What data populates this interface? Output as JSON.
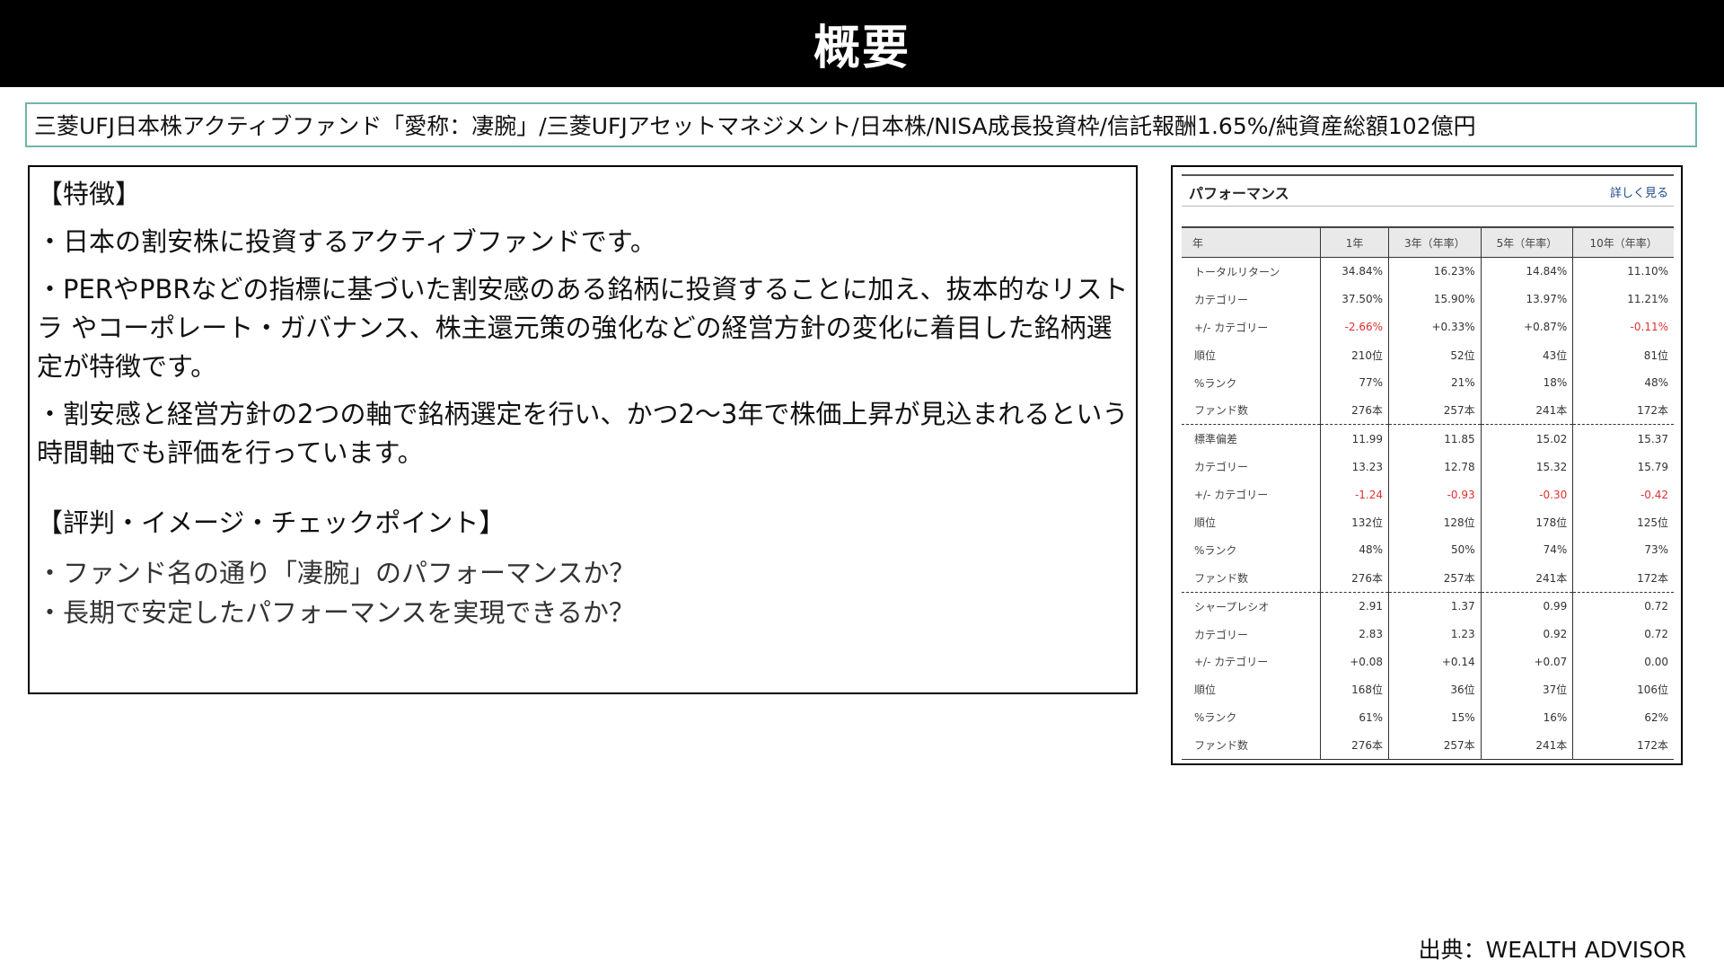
{
  "header": {
    "title": "概要"
  },
  "fund_line": "三菱UFJ日本株アクティブファンド「愛称：凄腕」/三菱UFJアセットマネジメント/日本株/NISA成長投資枠/信託報酬1.65%/純資産総額102億円",
  "features": {
    "heading": "【特徴】",
    "paragraphs": [
      "・日本の割安株に投資するアクティブファンドです。",
      "・PERやPBRなどの指標に基づいた割安感のある銘柄に投資することに加え、抜本的なリストラ やコーポレート・ガバナンス、株主還元策の強化などの経営方針の変化に着目した銘柄選定が特徴です。",
      "・割安感と経営方針の2つの軸で銘柄選定を行い、かつ2～3年で株価上昇が見込まれるという時間軸でも評価を行っています。"
    ]
  },
  "checkpoints": {
    "heading": "【評判・イメージ・チェックポイント】",
    "items": [
      "・ファンド名の通り「凄腕」のパフォーマンスか？",
      "・長期で安定したパフォーマンスを実現できるか？"
    ]
  },
  "performance": {
    "title": "パフォーマンス",
    "more_link": "詳しく見る",
    "columns": [
      "年",
      "1年",
      "3年（年率）",
      "5年（年率）",
      "10年（年率）"
    ],
    "rows": [
      [
        "トータルリターン",
        "34.84%",
        "16.23%",
        "14.84%",
        "11.10%"
      ],
      [
        "カテゴリー",
        "37.50%",
        "15.90%",
        "13.97%",
        "11.21%"
      ],
      [
        "+/- カテゴリー",
        "-2.66%",
        "+0.33%",
        "+0.87%",
        "-0.11%"
      ],
      [
        "順位",
        "210位",
        "52位",
        "43位",
        "81位"
      ],
      [
        "%ランク",
        "77%",
        "21%",
        "18%",
        "48%"
      ],
      [
        "ファンド数",
        "276本",
        "257本",
        "241本",
        "172本"
      ],
      [
        "標準偏差",
        "11.99",
        "11.85",
        "15.02",
        "15.37"
      ],
      [
        "カテゴリー",
        "13.23",
        "12.78",
        "15.32",
        "15.79"
      ],
      [
        "+/- カテゴリー",
        "-1.24",
        "-0.93",
        "-0.30",
        "-0.42"
      ],
      [
        "順位",
        "132位",
        "128位",
        "178位",
        "125位"
      ],
      [
        "%ランク",
        "48%",
        "50%",
        "74%",
        "73%"
      ],
      [
        "ファンド数",
        "276本",
        "257本",
        "241本",
        "172本"
      ],
      [
        "シャープレシオ",
        "2.91",
        "1.37",
        "0.99",
        "0.72"
      ],
      [
        "カテゴリー",
        "2.83",
        "1.23",
        "0.92",
        "0.72"
      ],
      [
        "+/- カテゴリー",
        "+0.08",
        "+0.14",
        "+0.07",
        "0.00"
      ],
      [
        "順位",
        "168位",
        "36位",
        "37位",
        "106位"
      ],
      [
        "%ランク",
        "61%",
        "15%",
        "16%",
        "62%"
      ],
      [
        "ファンド数",
        "276本",
        "257本",
        "241本",
        "172本"
      ]
    ],
    "negative_color": "#e03030"
  },
  "source": "出典：WEALTH ADVISOR"
}
